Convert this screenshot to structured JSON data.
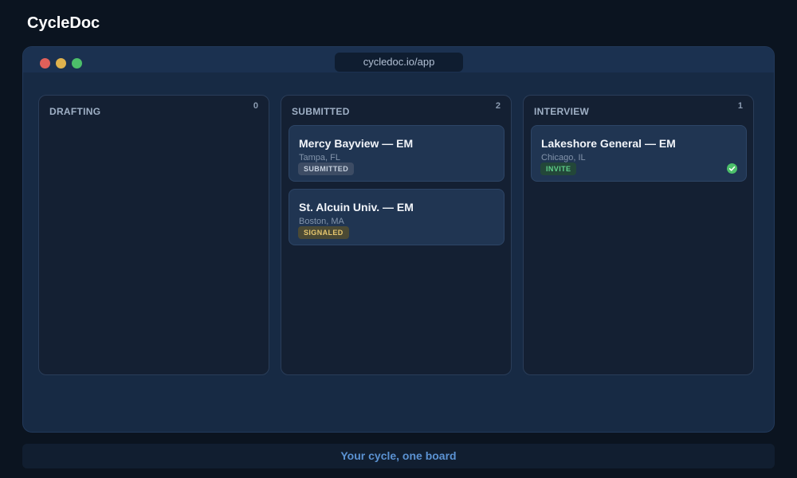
{
  "app": {
    "title": "CycleDoc"
  },
  "window": {
    "url": "cycledoc.io/app"
  },
  "board": {
    "columns": [
      {
        "title": "DRAFTING",
        "count": "0",
        "cards": []
      },
      {
        "title": "SUBMITTED",
        "count": "2",
        "cards": [
          {
            "title": "Mercy Bayview — EM",
            "location": "Tampa, FL",
            "badge": "SUBMITTED"
          },
          {
            "title": "St. Alcuin Univ. — EM",
            "location": "Boston, MA",
            "badge": "SIGNALED"
          }
        ]
      },
      {
        "title": "INTERVIEW",
        "count": "1",
        "cards": [
          {
            "title": "Lakeshore General — EM",
            "location": "Chicago, IL",
            "badge": "INVITE",
            "icon": "check-circle-icon"
          }
        ]
      }
    ]
  },
  "footer": {
    "tagline": "Your cycle, one board"
  },
  "colors": {
    "submitted_badge": "#3d4c64",
    "signaled_badge": "#4b4a35",
    "invite_badge": "#234739",
    "check": "#4cbf6a"
  }
}
